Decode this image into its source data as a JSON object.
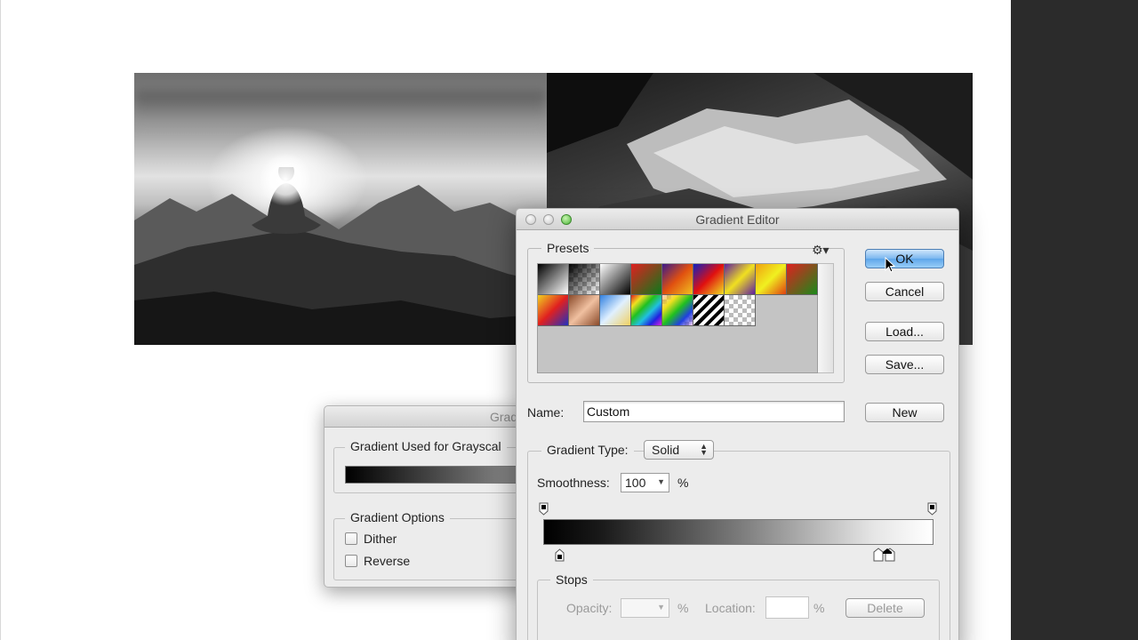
{
  "gradient_map": {
    "title": "Grad",
    "used_for_label": "Gradient Used for Grayscal",
    "options_label": "Gradient Options",
    "dither_label": "Dither",
    "reverse_label": "Reverse"
  },
  "gradient_editor": {
    "title": "Gradient Editor",
    "presets_label": "Presets",
    "buttons": {
      "ok": "OK",
      "cancel": "Cancel",
      "load": "Load...",
      "save": "Save...",
      "new": "New",
      "delete": "Delete"
    },
    "name_label": "Name:",
    "name_value": "Custom",
    "gradient_type_label": "Gradient Type:",
    "gradient_type_value": "Solid",
    "smoothness_label": "Smoothness:",
    "smoothness_value": "100",
    "percent": "%",
    "stops_label": "Stops",
    "opacity_label": "Opacity:",
    "location_label": "Location:",
    "accent": "#5ea6ea"
  },
  "icons": [
    "settings-gear-icon",
    "mouse-cursor-icon",
    "stepper-arrows-icon",
    "dropdown-arrow-icon"
  ]
}
